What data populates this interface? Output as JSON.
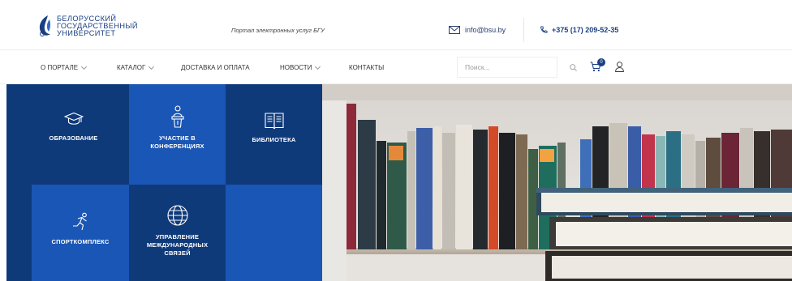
{
  "header": {
    "logo_lines": [
      "БЕЛОРУССКИЙ",
      "ГОСУДАРСТВЕННЫЙ",
      "УНИВЕРСИТЕТ"
    ],
    "tagline": "Портал электронных услуг БГУ",
    "email": "info@bsu.by",
    "phone": "+375 (17) 209-52-35"
  },
  "nav": {
    "items": [
      {
        "label": "О ПОРТАЛЕ"
      },
      {
        "label": "КАТАЛОГ"
      },
      {
        "label": "ДОСТАВКА И ОПЛАТА"
      },
      {
        "label": "НОВОСТИ"
      },
      {
        "label": "КОНТАКТЫ"
      }
    ],
    "search_placeholder": "Поиск...",
    "cart_count": "0"
  },
  "tiles": [
    {
      "label": "ОБРАЗОВАНИЕ",
      "icon": "graduation-cap-icon"
    },
    {
      "label": "УЧАСТИЕ В КОНФЕРЕНЦИЯХ",
      "icon": "podium-speaker-icon"
    },
    {
      "label": "БИБЛИОТЕКА",
      "icon": "open-book-icon"
    },
    {
      "label": "СПОРТКОМПЛЕКС",
      "icon": "running-man-icon"
    },
    {
      "label": "УПРАВЛЕНИЕ МЕЖДУНАРОДНЫХ СВЯЗЕЙ",
      "icon": "globe-icon"
    }
  ],
  "colors": {
    "brand": "#1a3e82",
    "tile_dark": "#0f3a7a",
    "tile_light": "#1a56b5"
  }
}
